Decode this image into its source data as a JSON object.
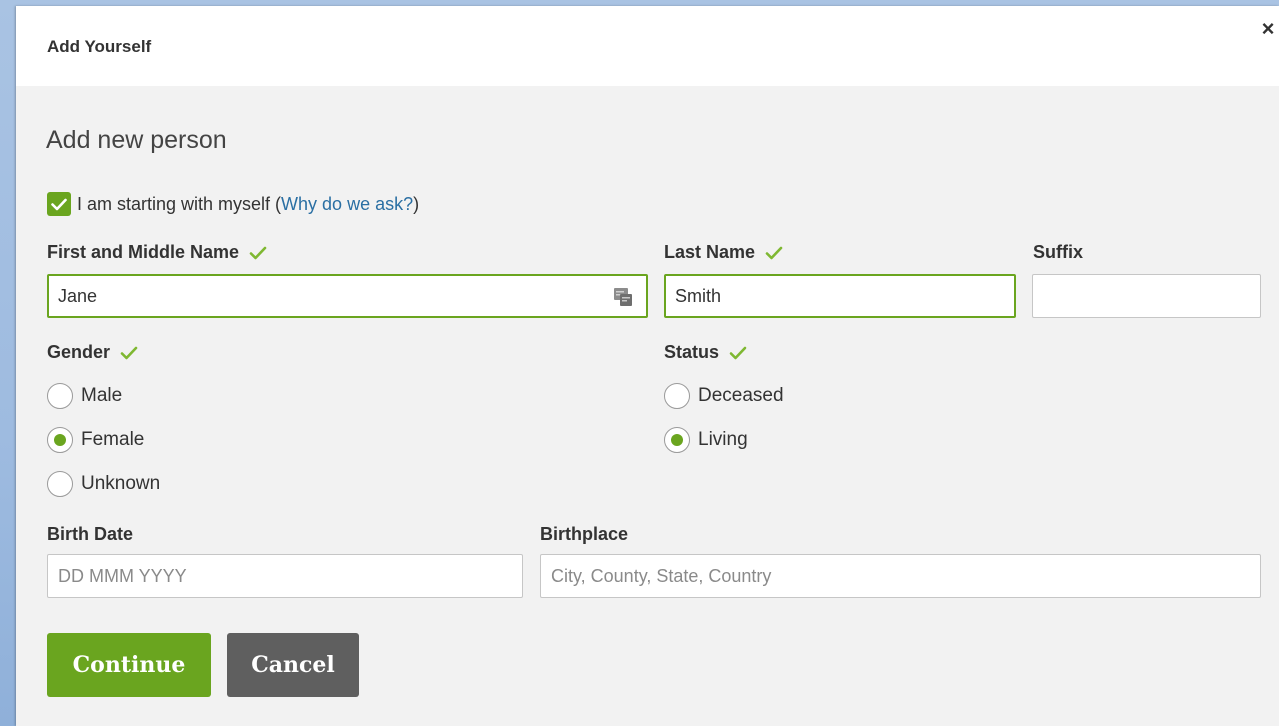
{
  "dialog": {
    "title": "Add Yourself",
    "close_symbol": "×",
    "subtitle": "Add new person"
  },
  "self_option": {
    "checked": true,
    "label": "I am starting with myself (",
    "link": "Why do we ask?",
    "suffix": ")"
  },
  "fields": {
    "first_name": {
      "label": "First and Middle Name",
      "value": "Jane",
      "valid": true
    },
    "last_name": {
      "label": "Last Name",
      "value": "Smith",
      "valid": true
    },
    "suffix": {
      "label": "Suffix",
      "value": ""
    },
    "birth_date": {
      "label": "Birth Date",
      "placeholder": "DD MMM YYYY"
    },
    "birthplace": {
      "label": "Birthplace",
      "placeholder": "City, County, State, Country"
    }
  },
  "gender": {
    "label": "Gender",
    "options": [
      "Male",
      "Female",
      "Unknown"
    ],
    "selected": "Female"
  },
  "status": {
    "label": "Status",
    "options": [
      "Deceased",
      "Living"
    ],
    "selected": "Living"
  },
  "buttons": {
    "continue": "Continue",
    "cancel": "Cancel"
  },
  "colors": {
    "accent_green": "#6aa51f",
    "cancel_gray": "#5f5f5f",
    "link_blue": "#2a6fa3"
  }
}
